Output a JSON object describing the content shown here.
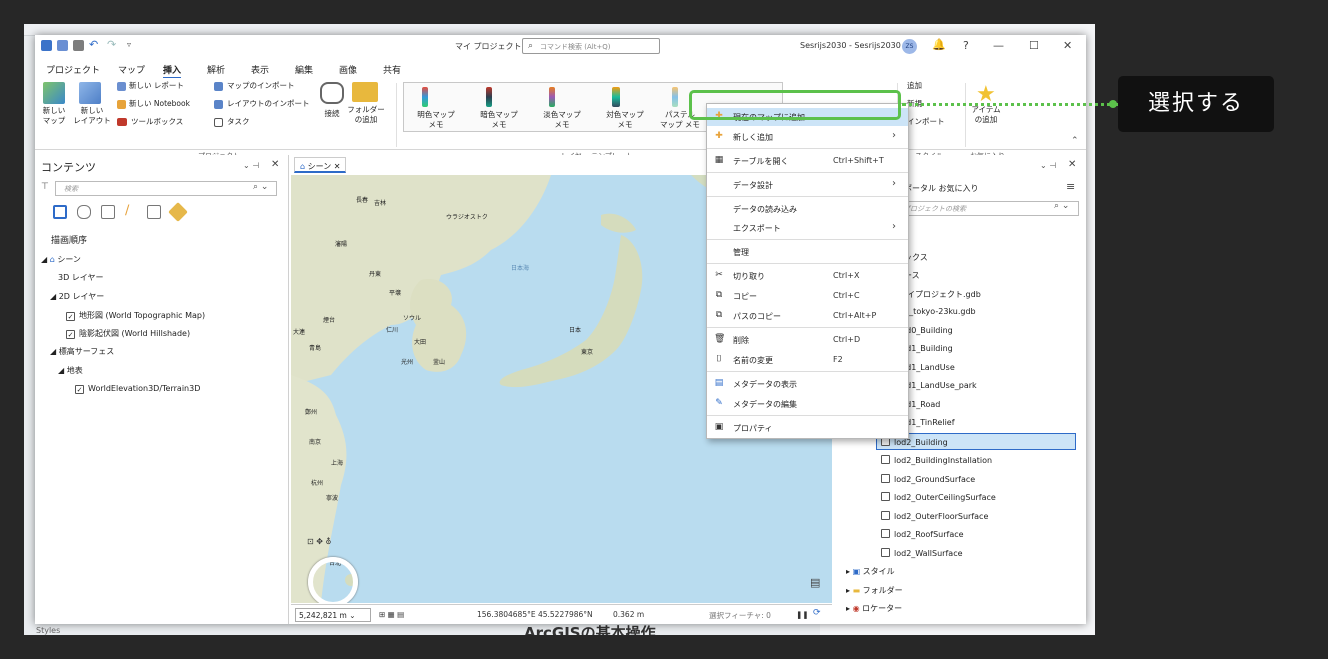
{
  "window": {
    "title": "マイ プロジェクト",
    "search_placeholder": "コマンド検索 (Alt+Q)",
    "user": "Sesrijs2030 - Sesrijs2030",
    "avatar": "ZS",
    "help": "?"
  },
  "menu_tabs": [
    "プロジェクト",
    "マップ",
    "挿入",
    "解析",
    "表示",
    "編集",
    "画像",
    "共有"
  ],
  "ribbon": {
    "new_map": "新しい\nマップ",
    "new_layout": "新しい\nレイアウト",
    "new_report": "新しい レポート",
    "new_notebook": "新しい Notebook",
    "toolbox": "ツールボックス",
    "import_map": "マップのインポート",
    "import_layout": "レイアウトのインポート",
    "task": "タスク",
    "connect": "接続",
    "add_folder": "フォルダー\nの追加",
    "group_project": "プロジェクト",
    "templates": [
      "明色マップ\nメモ",
      "暗色マップ\nメモ",
      "淡色マップ\nメモ",
      "対色マップ\nメモ",
      "パステル\nマップ メモ"
    ],
    "group_layer_template": "レイヤー テンプレート",
    "add": "追加",
    "new": "新規",
    "import": "インポート",
    "group_style": "スタイル",
    "add_item": "アイテム\nの追加",
    "group_favorites": "お気に入り"
  },
  "contents": {
    "title": "コンテンツ",
    "search_placeholder": "検索",
    "drawing_order": "描画順序",
    "scene": "シーン",
    "layers_3d": "3D レイヤー",
    "layers_2d": "2D レイヤー",
    "topo": "地形図 (World Topographic Map)",
    "hillshade": "陰影起伏図 (World Hillshade)",
    "elevation": "標高サーフェス",
    "ground": "地表",
    "terrain": "WorldElevation3D/Terrain3D"
  },
  "map": {
    "tab": "シーン",
    "labels": [
      "長春",
      "吉林",
      "ウラジオストク",
      "瀋陽",
      "丹東",
      "平壌",
      "日本海",
      "ソウル",
      "大連",
      "煙台",
      "仁川",
      "大田",
      "光州",
      "釜山",
      "青島",
      "日本",
      "東京",
      "鄭州",
      "南京",
      "上海",
      "杭州",
      "寧波",
      "台北"
    ],
    "scale": "5,242,821 m",
    "coords": "156.3804685°E 45.5227986°N",
    "elevation": "0.362 m",
    "selected_features": "選択フィーチャ: 0"
  },
  "catalog": {
    "tabs": "ポータル  お気に入り",
    "search_placeholder": "プロジェクトの検索",
    "items": [
      "ボックス",
      "ベース",
      "マイプロジェクト.gdb",
      "00_tokyo-23ku.gdb",
      "lod0_Building",
      "lod1_Building",
      "lod1_LandUse",
      "lod1_LandUse_park",
      "lod1_Road",
      "lod1_TinRelief",
      "lod2_Building",
      "lod2_BuildingInstallation",
      "lod2_GroundSurface",
      "lod2_OuterCeilingSurface",
      "lod2_OuterFloorSurface",
      "lod2_RoofSurface",
      "lod2_WallSurface"
    ],
    "styles": "スタイル",
    "folders": "フォルダー",
    "locators": "ロケーター"
  },
  "context_menu": {
    "add_to_current_map": "現在のマップに追加",
    "add_new": "新しく追加",
    "open_table": "テーブルを開く",
    "open_table_shortcut": "Ctrl+Shift+T",
    "data_design": "データ設計",
    "load_data": "データの読み込み",
    "export": "エクスポート",
    "manage": "管理",
    "cut": "切り取り",
    "cut_shortcut": "Ctrl+X",
    "copy": "コピー",
    "copy_shortcut": "Ctrl+C",
    "copy_path": "パスのコピー",
    "copy_path_shortcut": "Ctrl+Alt+P",
    "delete": "削除",
    "delete_shortcut": "Ctrl+D",
    "rename": "名前の変更",
    "rename_shortcut": "F2",
    "view_metadata": "メタデータの表示",
    "edit_metadata": "メタデータの編集",
    "properties": "プロパティ"
  },
  "callout": {
    "text": "選択する"
  },
  "background": {
    "caption": "ArcGISの基本操作",
    "styles": "Styles"
  },
  "colors": {
    "accent": "#2e6bc8",
    "highlight": "#5cc14b",
    "callout_bg": "#111111",
    "menu_hover": "#cce4f7"
  }
}
